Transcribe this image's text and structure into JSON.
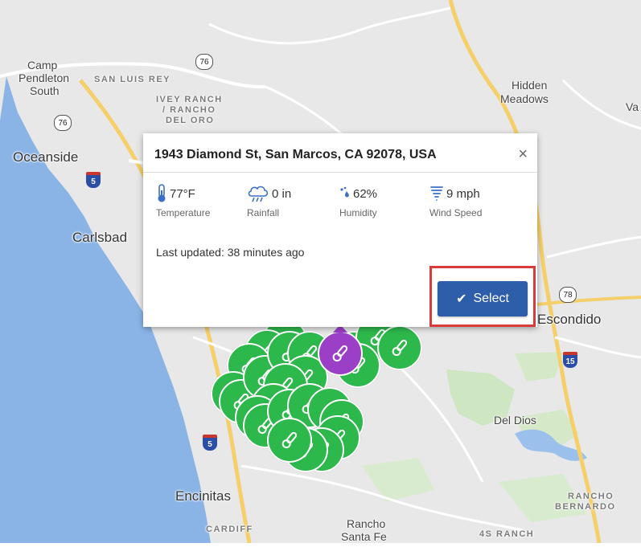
{
  "popup": {
    "title": "1943 Diamond St, San Marcos, CA 92078, USA",
    "close": "×",
    "metrics": [
      {
        "value": "77°F",
        "label": "Temperature",
        "icon": "thermometer-icon"
      },
      {
        "value": "0 in",
        "label": "Rainfall",
        "icon": "rain-cloud-icon"
      },
      {
        "value": "62%",
        "label": "Humidity",
        "icon": "humidity-drops-icon"
      },
      {
        "value": "9 mph",
        "label": "Wind Speed",
        "icon": "wind-icon"
      }
    ],
    "last_updated": "Last updated: 38 minutes ago",
    "select_label": "Select"
  },
  "map": {
    "places": {
      "camp_pendleton": "Camp",
      "camp_pendleton_2": "Pendleton",
      "camp_pendleton_3": "South",
      "san_luis_rey": "SAN LUIS REY",
      "ivey_ranch": "IVEY RANCH",
      "rancho_del_oro": "/ RANCHO",
      "del_oro": "DEL ORO",
      "hidden_meadows": "Hidden",
      "hidden_meadows_2": "Meadows",
      "va": "Va",
      "oceanside": "Oceanside",
      "carlsbad": "Carlsbad",
      "escondido": "Escondido",
      "del_dios": "Del Dios",
      "encinitas": "Encinitas",
      "cardiff": "CARDIFF",
      "rancho_santa_fe": "Rancho",
      "rancho_santa_fe_2": "Santa Fe",
      "rancho_bernardo": "RANCHO",
      "rancho_bernardo_2": "BERNARDO",
      "four_s_ranch": "4S RANCH"
    },
    "shields": {
      "r76_top": "76",
      "r76_left": "76",
      "r78": "78",
      "i5_top": "5",
      "i5_bottom": "5",
      "i15": "15"
    },
    "colors": {
      "ocean": "#8ab4e6",
      "land": "#e8e8e8",
      "marker": "#2db84b",
      "selected_marker": "#9c3fc7",
      "highway": "#f5cf6a",
      "park": "#cfe6c3",
      "button": "#2e5ea9",
      "highlight": "#d93a3a"
    },
    "station_count": 25
  }
}
